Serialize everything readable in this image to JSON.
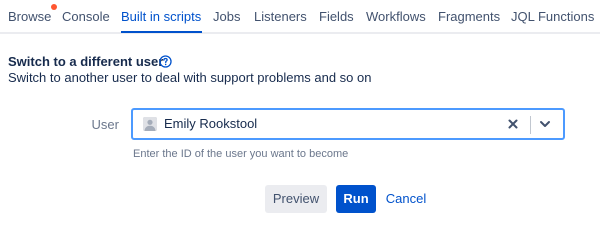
{
  "tabs": [
    {
      "label": "Browse",
      "has_notification": true
    },
    {
      "label": "Console"
    },
    {
      "label": "Built in scripts",
      "active": true
    },
    {
      "label": "Jobs"
    },
    {
      "label": "Listeners"
    },
    {
      "label": "Fields"
    },
    {
      "label": "Workflows"
    },
    {
      "label": "Fragments"
    },
    {
      "label": "JQL Functions"
    }
  ],
  "form": {
    "title": "Switch to a different user",
    "description": "Switch to another user to deal with support problems and so on",
    "user_field": {
      "label": "User",
      "value": "Emily Rookstool",
      "helper": "Enter the ID of the user you want to become"
    }
  },
  "buttons": {
    "preview": "Preview",
    "run": "Run",
    "cancel": "Cancel"
  },
  "colors": {
    "accent": "#0052cc",
    "notification_dot": "#ff5630",
    "focus_border": "#4c9aff"
  },
  "icons": {
    "help": "help-icon",
    "clear": "close-icon",
    "dropdown": "chevron-down-icon",
    "avatar": "avatar-placeholder-icon"
  }
}
